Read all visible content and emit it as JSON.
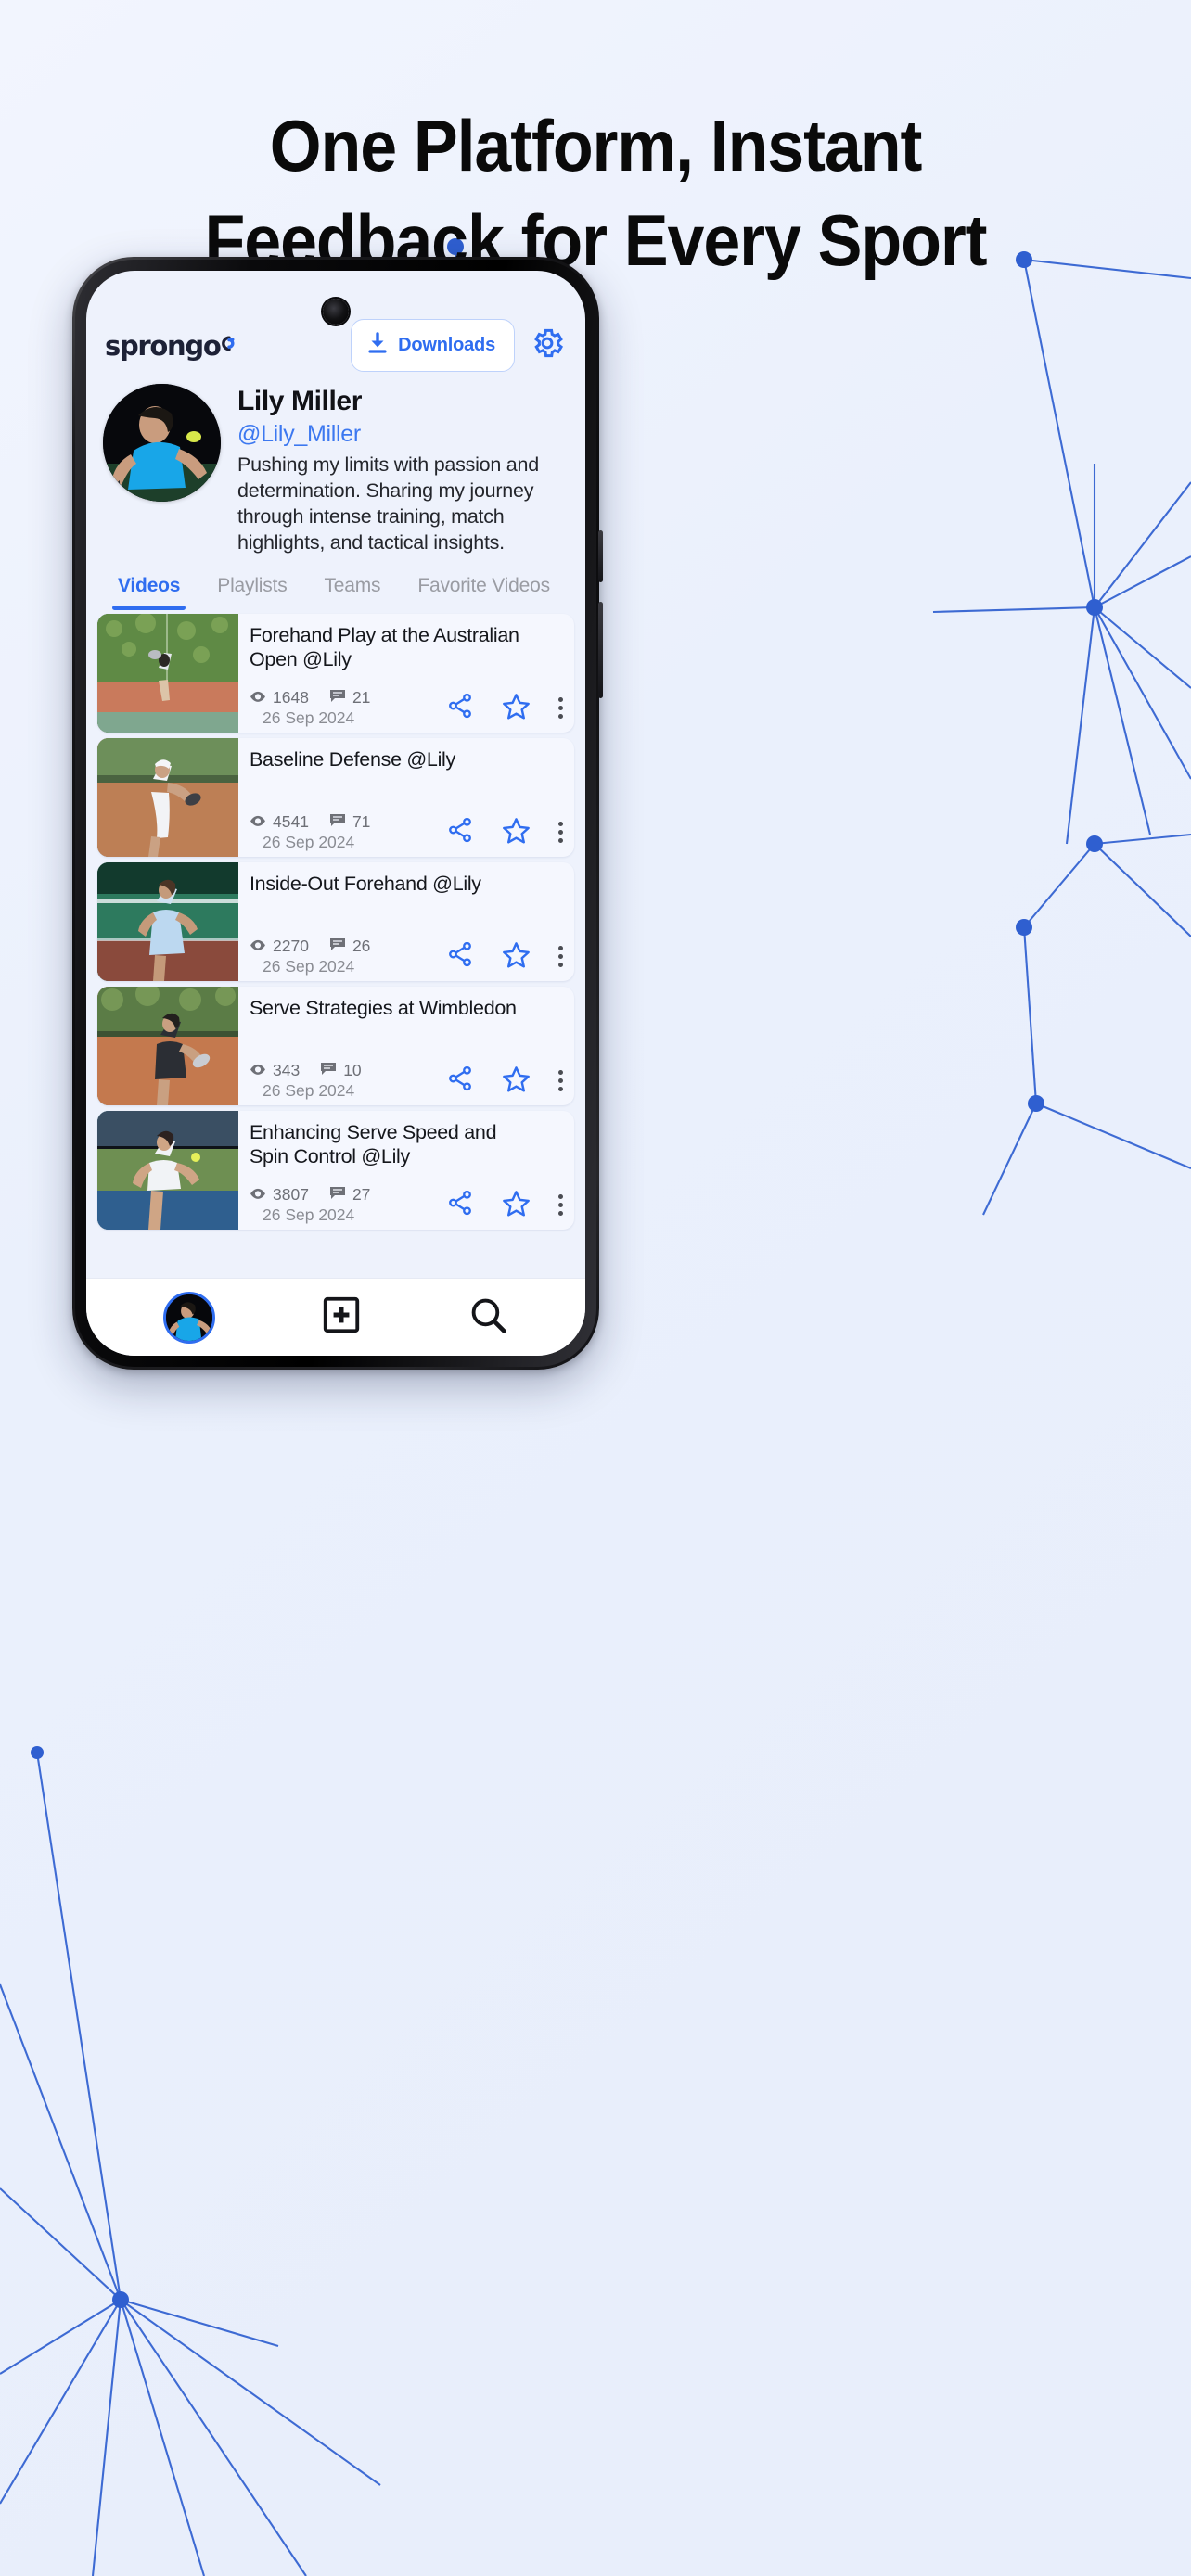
{
  "page": {
    "background_color": "#eef2fc",
    "accent_color": "#2f6df0"
  },
  "headline": {
    "line1": "One Platform, Instant",
    "line2": "Feedback for Every Sport"
  },
  "app": {
    "logo_text": "sprongo",
    "header": {
      "downloads_label": "Downloads",
      "download_icon": "download-arrow-icon",
      "settings_icon": "gear-icon"
    },
    "profile": {
      "name": "Lily Miller",
      "handle": "@Lily_Miller",
      "bio": "Pushing my limits with passion and determination. Sharing my journey through intense training, match highlights, and tactical insights."
    },
    "tabs": [
      {
        "label": "Videos",
        "active": true
      },
      {
        "label": "Playlists",
        "active": false
      },
      {
        "label": "Teams",
        "active": false
      },
      {
        "label": "Favorite Videos",
        "active": false
      }
    ],
    "videos": [
      {
        "title": "Forehand Play at the Australian Open @Lily",
        "views": "1648",
        "comments": "21",
        "date": "26 Sep 2024"
      },
      {
        "title": "Baseline Defense @Lily",
        "views": "4541",
        "comments": "71",
        "date": "26 Sep 2024"
      },
      {
        "title": "Inside-Out Forehand @Lily",
        "views": "2270",
        "comments": "26",
        "date": "26 Sep 2024"
      },
      {
        "title": "Serve Strategies at Wimbledon",
        "views": "343",
        "comments": "10",
        "date": "26 Sep 2024"
      },
      {
        "title": "Enhancing Serve Speed and Spin Control @Lily",
        "views": "3807",
        "comments": "27",
        "date": "26 Sep 2024"
      }
    ],
    "card_icons": {
      "views_icon": "eye-icon",
      "comments_icon": "comment-icon",
      "share_icon": "share-icon",
      "favorite_icon": "star-icon",
      "more_icon": "more-vertical-icon"
    },
    "bottom_nav": {
      "profile_icon": "user-avatar-icon",
      "upload_icon": "plus-square-icon",
      "search_icon": "search-icon"
    }
  }
}
